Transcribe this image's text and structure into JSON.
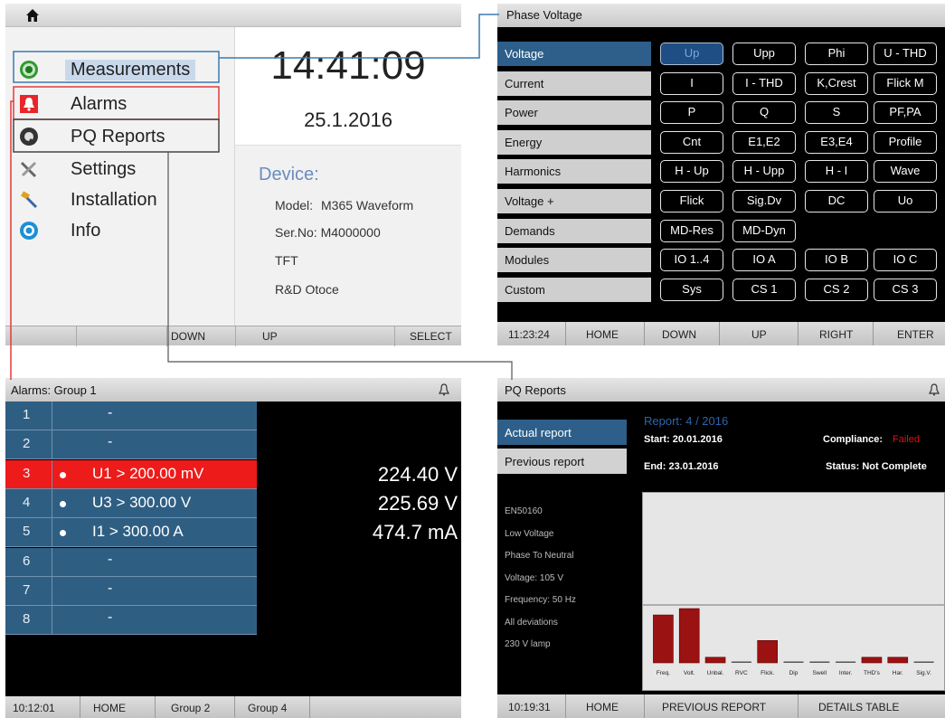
{
  "main_menu": {
    "items": [
      {
        "label": "Measurements",
        "icon": "measurements-icon"
      },
      {
        "label": "Alarms",
        "icon": "alarm-bell-icon"
      },
      {
        "label": "PQ Reports",
        "icon": "pq-reports-icon"
      },
      {
        "label": "Settings",
        "icon": "settings-tools-icon"
      },
      {
        "label": "Installation",
        "icon": "installation-icon"
      },
      {
        "label": "Info",
        "icon": "info-icon"
      }
    ],
    "time": "14:41:09",
    "date": "25.1.2016",
    "device_heading": "Device:",
    "model_label": "Model:",
    "model_value": "M365 Waveform",
    "serial": "Ser.No: M4000000",
    "tft": "TFT",
    "rd": "R&D Otoce",
    "footer": {
      "down": "DOWN",
      "up": "UP",
      "select": "SELECT"
    }
  },
  "phase_voltage": {
    "title": "Phase Voltage",
    "categories": [
      "Voltage",
      "Current",
      "Power",
      "Energy",
      "Harmonics",
      "Voltage +",
      "Demands",
      "Modules",
      "Custom"
    ],
    "buttons": [
      [
        "Up",
        "Upp",
        "Phi",
        "U - THD"
      ],
      [
        "I",
        "I - THD",
        "K,Crest",
        "Flick M"
      ],
      [
        "P",
        "Q",
        "S",
        "PF,PA"
      ],
      [
        "Cnt",
        "E1,E2",
        "E3,E4",
        "Profile"
      ],
      [
        "H - Up",
        "H - Upp",
        "H - I",
        "Wave"
      ],
      [
        "Flick",
        "Sig.Dv",
        "DC",
        "Uo"
      ],
      [
        "MD-Res",
        "MD-Dyn",
        "",
        ""
      ],
      [
        "IO 1..4",
        "IO A",
        "IO B",
        "IO C"
      ],
      [
        "Sys",
        "CS 1",
        "CS 2",
        "CS 3"
      ]
    ],
    "footer": {
      "time": "11:23:24",
      "home": "HOME",
      "down": "DOWN",
      "up": "UP",
      "right": "RIGHT",
      "enter": "ENTER"
    }
  },
  "alarms": {
    "title": "Alarms: Group 1",
    "rows": [
      {
        "n": "1",
        "text": "-",
        "value": "",
        "active": false
      },
      {
        "n": "2",
        "text": "-",
        "value": "",
        "active": false
      },
      {
        "n": "3",
        "text": "U1 > 200.00 mV",
        "value": "224.40 V",
        "active": true
      },
      {
        "n": "4",
        "text": "U3 > 300.00 V",
        "value": "225.69 V",
        "active": false
      },
      {
        "n": "5",
        "text": "I1 > 300.00 A",
        "value": "474.7 mA",
        "active": false
      },
      {
        "n": "6",
        "text": "-",
        "value": "",
        "active": false
      },
      {
        "n": "7",
        "text": "-",
        "value": "",
        "active": false
      },
      {
        "n": "8",
        "text": "-",
        "value": "",
        "active": false
      }
    ],
    "footer": {
      "time": "10:12:01",
      "home": "HOME",
      "group2": "Group 2",
      "group4": "Group 4"
    }
  },
  "pq_reports": {
    "title": "PQ Reports",
    "actual_btn": "Actual report",
    "previous_btn": "Previous report",
    "report": "Report: 4 / 2016",
    "start": "Start: 20.01.2016",
    "end": "End: 23.01.2016",
    "compliance_label": "Compliance:",
    "compliance_value": "Failed",
    "status": "Status: Not Complete",
    "info": [
      "EN50160",
      "Low Voltage",
      "Phase To Neutral",
      "Voltage: 105 V",
      "Frequency: 50 Hz",
      "All deviations",
      "230 V lamp"
    ],
    "footer": {
      "time": "10:19:31",
      "home": "HOME",
      "prev": "PREVIOUS REPORT",
      "details": "DETAILS TABLE"
    }
  },
  "chart_data": {
    "type": "bar",
    "categories": [
      "Freq.",
      "Volt.",
      "Unbal.",
      "RVC",
      "Flick.",
      "Dip",
      "Swell",
      "Inter.",
      "THD's",
      "Har.",
      "Sig.V."
    ],
    "values": [
      60,
      68,
      7,
      0,
      28,
      0,
      0,
      0,
      7,
      7,
      0
    ],
    "ylim": [
      0,
      100
    ],
    "bar_color": "#9b1212"
  }
}
